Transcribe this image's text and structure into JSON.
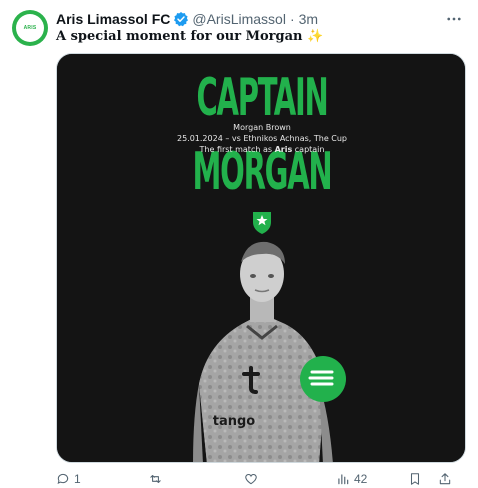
{
  "tweet": {
    "display_name": "Aris Limassol FC",
    "handle": "@ArisLimassol",
    "separator": "·",
    "time": "3m",
    "text": "A special moment for our Morgan",
    "emoji": "✨",
    "avatar_text": "ARIS"
  },
  "media": {
    "title_line1": "CAPTAIN",
    "title_line2": "MORGAN",
    "caption_line1": "Morgan Brown",
    "caption_line2": "25.01.2024 – vs Ethnikos Achnas, The Cup",
    "caption_line3_prefix": "The first match as ",
    "caption_line3_bold": "Aris",
    "caption_line3_suffix": " captain",
    "shirt_sponsor": "tango",
    "colors": {
      "accent": "#22b14c",
      "background": "#121212"
    }
  },
  "actions": {
    "reply_count": "1",
    "views_count": "42"
  }
}
